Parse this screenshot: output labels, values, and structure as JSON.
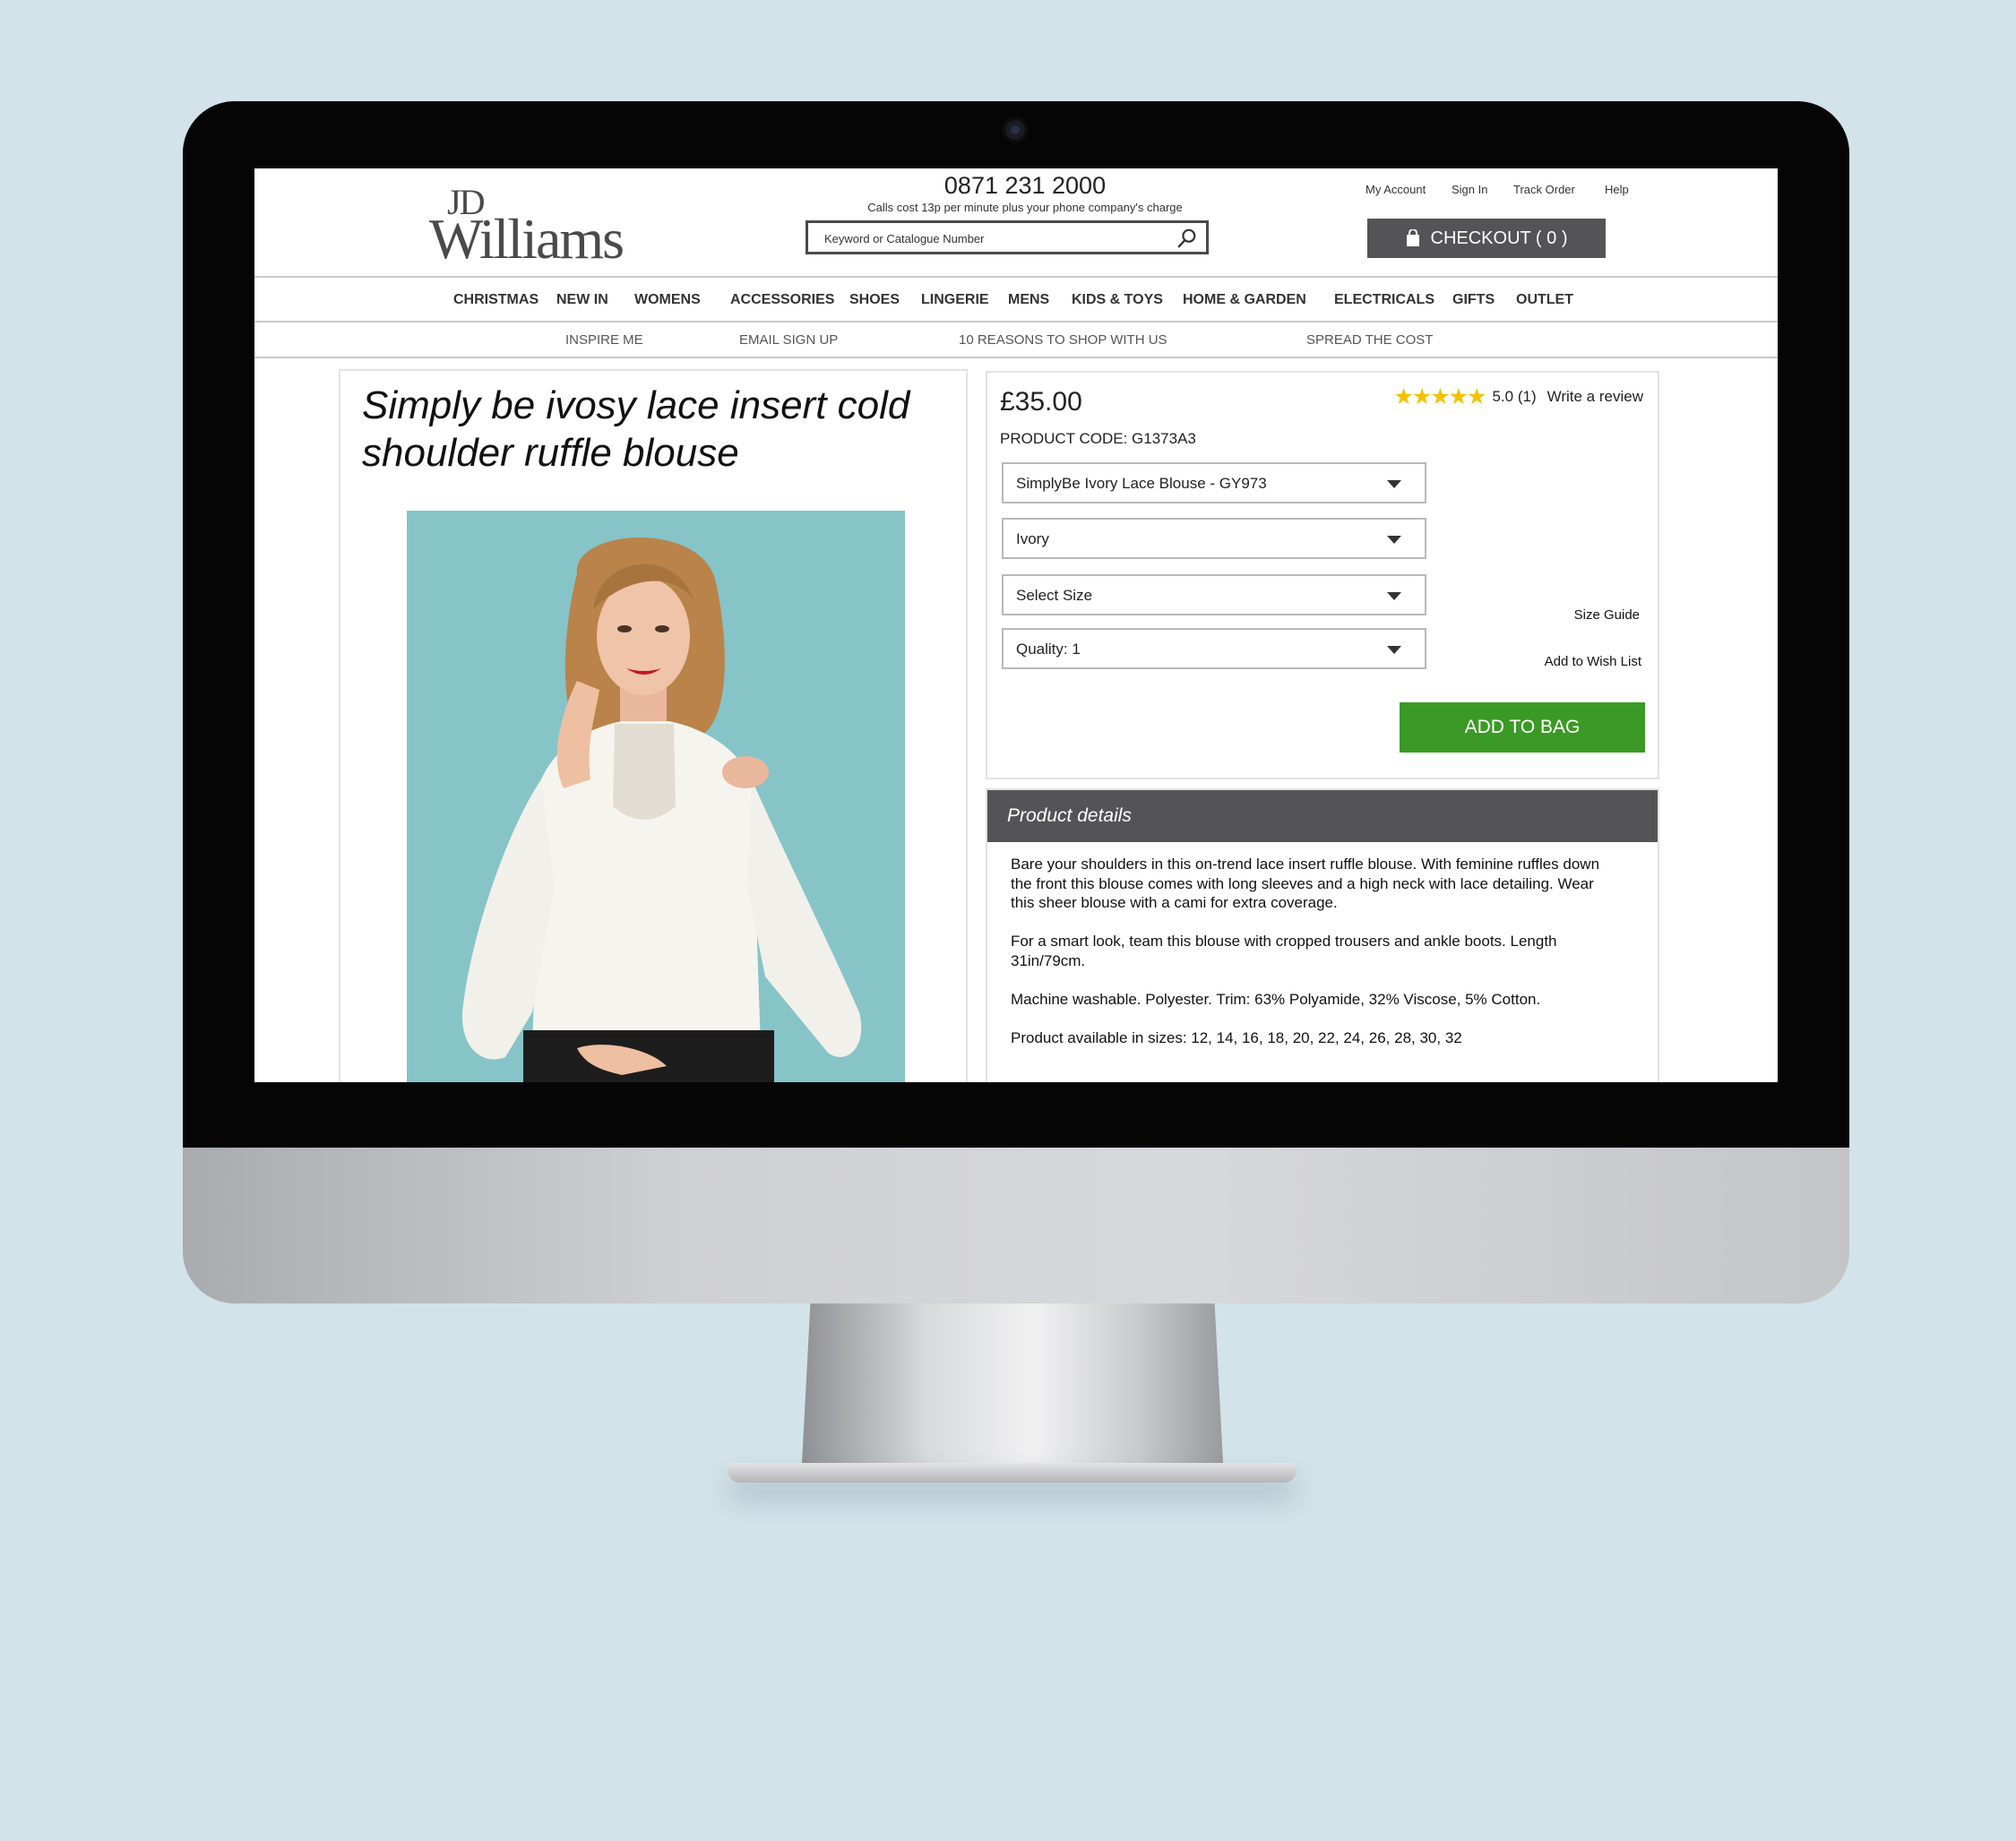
{
  "header": {
    "logo_top": "JD",
    "logo_main": "Williams",
    "phone": "0871 231 2000",
    "phone_note": "Calls cost 13p per minute plus your phone company's charge",
    "search_placeholder": "Keyword or Catalogue Number",
    "links": [
      "My Account",
      "Sign In",
      "Track Order",
      "Help"
    ],
    "checkout_label": "CHECKOUT ( 0 )"
  },
  "nav": {
    "items": [
      "CHRISTMAS",
      "NEW IN",
      "WOMENS",
      "ACCESSORIES",
      "SHOES",
      "LINGERIE",
      "MENS",
      "KIDS & TOYS",
      "HOME & GARDEN",
      "ELECTRICALS",
      "GIFTS",
      "OUTLET"
    ]
  },
  "subnav": {
    "items": [
      "INSPIRE ME",
      "EMAIL SIGN UP",
      "10 REASONS TO SHOP WITH US",
      "SPREAD THE COST"
    ]
  },
  "product": {
    "title": "Simply be ivosy lace insert cold shoulder ruffle blouse",
    "price": "£35.00",
    "code": "PRODUCT CODE: G1373A3",
    "stars": "★★★★★",
    "rating": 5.0,
    "rating_text": "5.0 (1)",
    "review_link": "Write a review",
    "selects": [
      "SimplyBe Ivory Lace Blouse - GY973",
      "Ivory",
      "Select Size",
      "Quality: 1"
    ],
    "size_guide": "Size Guide",
    "wishlist": "Add to Wish List",
    "add_to_bag": "ADD TO BAG"
  },
  "details": {
    "heading": "Product details",
    "paragraphs": [
      "Bare your shoulders in this on-trend lace insert ruffle blouse. With feminine ruffles down the front this blouse comes with long sleeves and a high neck with lace detailing. Wear this sheer blouse with a cami for extra coverage.",
      "For a smart look, team this blouse with cropped trousers and ankle boots. Length 31in/79cm.",
      "Machine washable. Polyester. Trim: 63% Polyamide, 32% Viscose, 5% Cotton.",
      "Product available in sizes: 12, 14, 16, 18, 20, 22, 24, 26, 28, 30, 32"
    ]
  },
  "colors": {
    "add_to_bag": "#3b9a25",
    "dark_bar": "#545456",
    "star": "#f2c200",
    "image_bg": "#86c4c8"
  }
}
